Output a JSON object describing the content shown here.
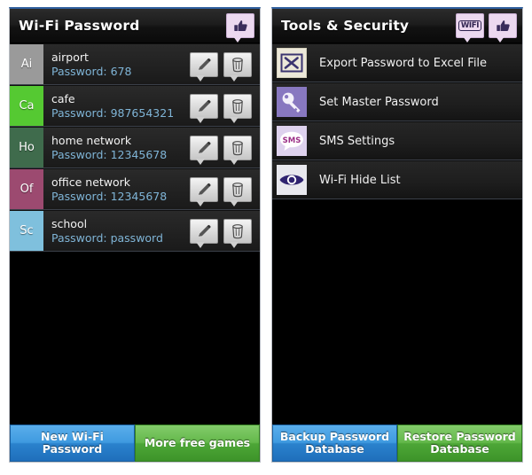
{
  "theme": {
    "accent_blue": "#2f5f9e",
    "password_text_color": "#7fb4d6",
    "button_blue": "#3f9ae0",
    "button_green": "#64b84b",
    "row_divider": "#3b4049",
    "bubble_badge_bg": "#ecd9f0"
  },
  "left_screen": {
    "title": "Wi-Fi Password",
    "titlebar_actions": [
      {
        "name": "thumbs-up-icon",
        "label": "Rate app"
      }
    ],
    "networks": [
      {
        "initials": "Ai",
        "avatar_color": "#9a9a9a",
        "ssid": "airport",
        "password_label": "Password: 678",
        "edit_icon": "pencil-icon",
        "delete_icon": "trash-icon"
      },
      {
        "initials": "Ca",
        "avatar_color": "#55c932",
        "ssid": "cafe",
        "password_label": "Password: 987654321",
        "edit_icon": "pencil-icon",
        "delete_icon": "trash-icon"
      },
      {
        "initials": "Ho",
        "avatar_color": "#3f6b4c",
        "ssid": "home network",
        "password_label": "Password: 12345678",
        "edit_icon": "pencil-icon",
        "delete_icon": "trash-icon"
      },
      {
        "initials": "Of",
        "avatar_color": "#9c4a70",
        "ssid": "office network",
        "password_label": "Password: 12345678",
        "edit_icon": "pencil-icon",
        "delete_icon": "trash-icon"
      },
      {
        "initials": "Sc",
        "avatar_color": "#7fc0dd",
        "ssid": "school",
        "password_label": "Password: password",
        "edit_icon": "pencil-icon",
        "delete_icon": "trash-icon"
      }
    ],
    "buttons": {
      "primary": "New Wi-Fi Password",
      "secondary": "More free games"
    }
  },
  "right_screen": {
    "title": "Tools & Security",
    "titlebar_actions": [
      {
        "name": "wifi-badge-icon",
        "label": "WiFi"
      },
      {
        "name": "thumbs-up-icon",
        "label": "Rate app"
      }
    ],
    "wifi_badge_text": "WIFI",
    "tools": [
      {
        "icon": "excel-export-icon",
        "label": "Export Password to Excel File"
      },
      {
        "icon": "key-icon",
        "label": "Set Master Password"
      },
      {
        "icon": "sms-icon",
        "label": "SMS Settings",
        "icon_text": "SMS"
      },
      {
        "icon": "eye-icon",
        "label": "Wi-Fi Hide List"
      }
    ],
    "buttons": {
      "primary_line1": "Backup Password",
      "primary_line2": "Database",
      "secondary_line1": "Restore Password",
      "secondary_line2": "Database"
    }
  }
}
